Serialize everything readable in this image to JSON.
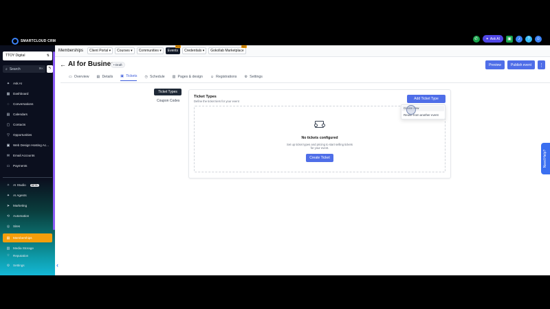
{
  "brand": {
    "logo_text": "SMARTCLOUD CRM"
  },
  "header": {
    "ask_ai": "Ask AI"
  },
  "sidebar": {
    "location": "TTOY Digital",
    "search_placeholder": "Search",
    "search_shortcut": "⌘K",
    "items": [
      {
        "label": "Ask AI",
        "icon": "sparkle-icon"
      },
      {
        "label": "Dashboard",
        "icon": "dashboard-icon"
      },
      {
        "label": "Conversations",
        "icon": "chat-icon"
      },
      {
        "label": "Calendars",
        "icon": "calendar-icon"
      },
      {
        "label": "Contacts",
        "icon": "contacts-icon"
      },
      {
        "label": "Opportunities",
        "icon": "funnel-icon"
      },
      {
        "label": "Web Design Hosting Ac...",
        "icon": "globe-icon"
      },
      {
        "label": "Email Accounts",
        "icon": "mail-icon"
      },
      {
        "label": "Payments",
        "icon": "card-icon"
      }
    ],
    "items2": [
      {
        "label": "AI Studio",
        "icon": "ai-icon",
        "badge": "BETA"
      },
      {
        "label": "AI Agents",
        "icon": "robot-icon"
      },
      {
        "label": "Marketing",
        "icon": "send-icon"
      },
      {
        "label": "Automation",
        "icon": "automation-icon"
      },
      {
        "label": "Sites",
        "icon": "sites-icon"
      },
      {
        "label": "Memberships",
        "icon": "membership-icon",
        "active": true
      },
      {
        "label": "Media Storage",
        "icon": "media-icon"
      },
      {
        "label": "Reputation",
        "icon": "star-icon"
      },
      {
        "label": "Settings",
        "icon": "gear-icon"
      }
    ]
  },
  "topbar": {
    "title": "Memberships",
    "items": [
      {
        "label": "Client Portal ▾"
      },
      {
        "label": "Courses ▾"
      },
      {
        "label": "Communities ▾"
      },
      {
        "label": "Events",
        "active": true,
        "badge": "New"
      },
      {
        "label": "Credentials ▾"
      },
      {
        "label": "Gokollab Marketplace",
        "badge": "New"
      }
    ]
  },
  "page": {
    "title": "AI for Business",
    "status": "• Draft",
    "preview": "Preview",
    "publish": "Publish event",
    "more": "⋮"
  },
  "tabs": [
    {
      "label": "Overview",
      "icon": "overview-icon"
    },
    {
      "label": "Details",
      "icon": "doc-icon"
    },
    {
      "label": "Tickets",
      "icon": "ticket-icon",
      "active": true
    },
    {
      "label": "Schedule",
      "icon": "calendar-icon"
    },
    {
      "label": "Pages & design",
      "icon": "pages-icon"
    },
    {
      "label": "Registrations",
      "icon": "people-icon"
    },
    {
      "label": "Settings",
      "icon": "gear-icon"
    }
  ],
  "subnav": {
    "active": "Ticket Types",
    "item": "Coupon Codes"
  },
  "card": {
    "title": "Ticket Types",
    "subtitle": "Define the ticket tiers for your event",
    "add_button": "Add Ticket Type",
    "dropdown": [
      "Create new",
      "Reuse from another event"
    ],
    "empty_title": "No tickets configured",
    "empty_desc": "Set up ticket types and pricing to start selling tickets for your event.",
    "create_button": "Create Ticket"
  },
  "help": "Need Help?"
}
